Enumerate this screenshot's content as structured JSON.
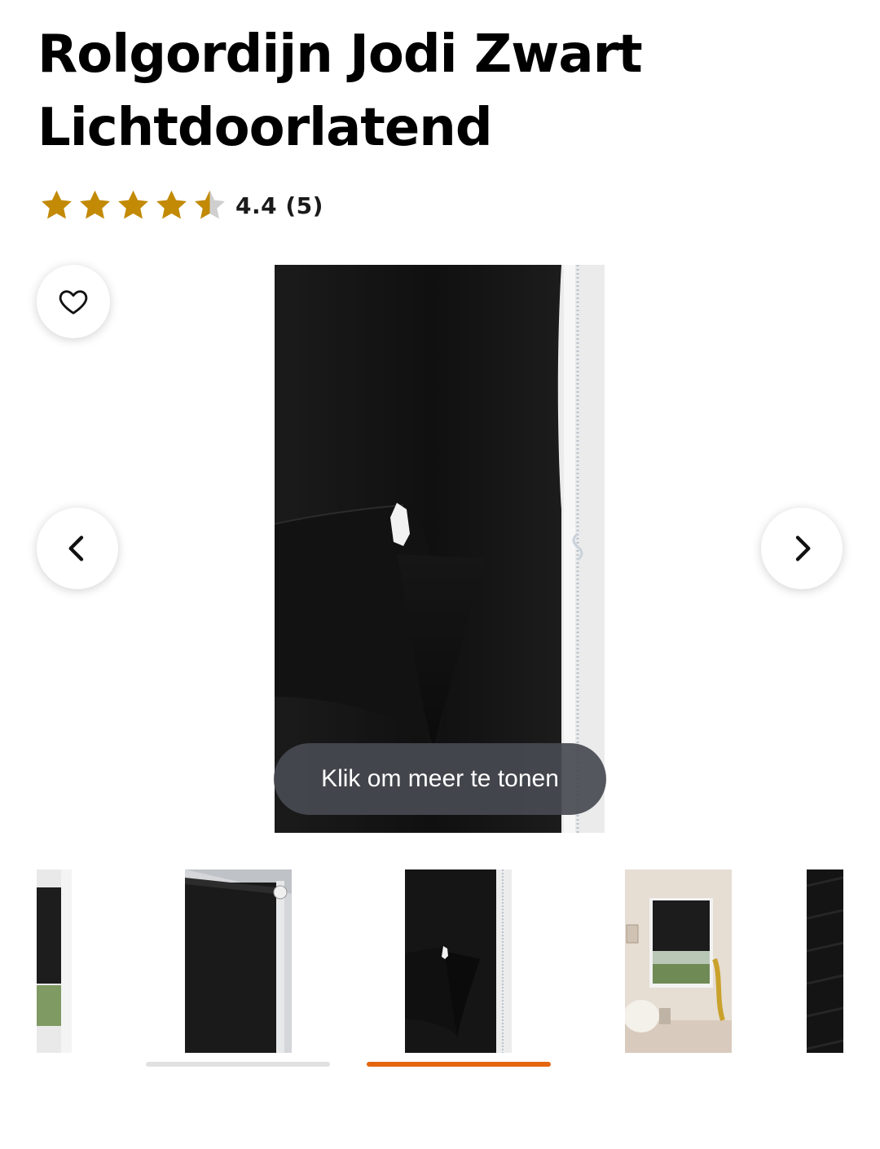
{
  "product": {
    "title_line1": "Rolgordijn Jodi Zwart",
    "title_line2": "Lichtdoorlatend"
  },
  "rating": {
    "value": 4.4,
    "max": 5,
    "text": "4.4 (5)",
    "star_color": "#c28a05",
    "empty_star_color": "#cfcfcf"
  },
  "gallery": {
    "more_button_label": "Klik om meer te tonen",
    "icons": {
      "favorite": "heart-icon",
      "previous": "chevron-left-icon",
      "next": "chevron-right-icon"
    },
    "thumbnails": [
      "roller blind in window",
      "roller blind side mount",
      "roller blind curled bottom",
      "roller blind in room",
      "fabric texture close-up"
    ],
    "active_thumbnail": 3,
    "accent_color": "#e3660f"
  }
}
